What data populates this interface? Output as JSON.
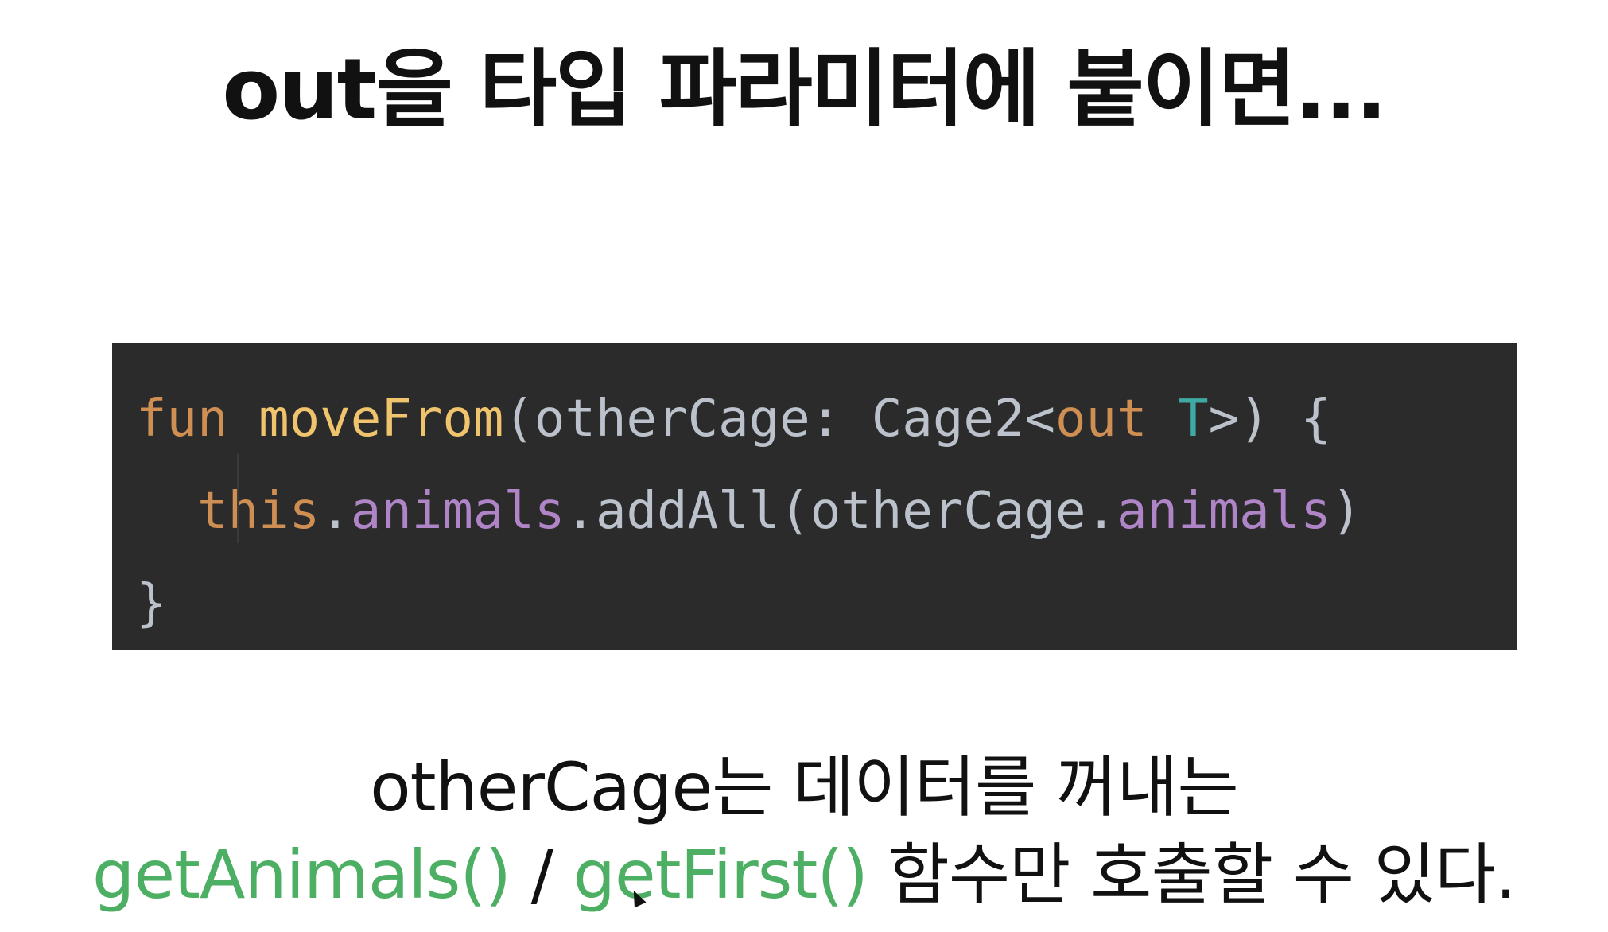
{
  "title": "out을 타입 파라미터에 붙이면...",
  "code": {
    "line1": {
      "kw_fun": "fun",
      "space1": " ",
      "fn_name": "moveFrom",
      "params_open": "(otherCage: Cage2<",
      "kw_out": "out",
      "space2": " ",
      "type_param": "T",
      "params_close": ">) {"
    },
    "line2": {
      "indent": "  ",
      "kw_this": "this",
      "dot1": ".",
      "prop1": "animals",
      "call": ".addAll(otherCage.",
      "prop2": "animals",
      "close": ")"
    },
    "line3": {
      "brace": "}"
    }
  },
  "caption": {
    "line1": "otherCage는 데이터를 꺼내는",
    "line2": {
      "fn1": "getAnimals()",
      "sep": " / ",
      "fn2": "getFirst()",
      "rest": " 함수만 호출할 수 있다."
    }
  },
  "colors": {
    "background": "#ffffff",
    "code_background": "#2b2b2c",
    "keyword": "#cf8e52",
    "function": "#f0c46c",
    "plain": "#bcc2cc",
    "type_param": "#3fa9a4",
    "property": "#b085c7",
    "caption_green": "#4caf63"
  },
  "icons": {
    "cursor": "mouse-pointer-icon"
  }
}
